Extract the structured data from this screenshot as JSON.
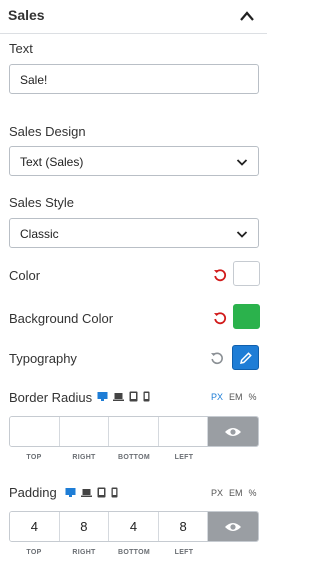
{
  "header": {
    "title": "Sales"
  },
  "text_field": {
    "label": "Text",
    "value": "Sale!"
  },
  "sales_design": {
    "label": "Sales Design",
    "value": "Text (Sales)"
  },
  "sales_style": {
    "label": "Sales Style",
    "value": "Classic"
  },
  "color": {
    "label": "Color",
    "swatch": "#ffffff"
  },
  "background_color": {
    "label": "Background Color",
    "swatch": "#2bb24c"
  },
  "typography": {
    "label": "Typography"
  },
  "border_radius": {
    "label": "Border Radius",
    "units": [
      "PX",
      "EM",
      "%"
    ],
    "active_unit": "PX",
    "values": [
      "",
      "",
      "",
      ""
    ],
    "sides": [
      "TOP",
      "RIGHT",
      "BOTTOM",
      "LEFT"
    ]
  },
  "padding": {
    "label": "Padding",
    "units": [
      "PX",
      "EM",
      "%"
    ],
    "active_unit": "PX",
    "values": [
      "4",
      "8",
      "4",
      "8"
    ],
    "sides": [
      "TOP",
      "RIGHT",
      "BOTTOM",
      "LEFT"
    ]
  },
  "colors": {
    "accent": "#1e7dd6",
    "reset_red": "#d11a1a",
    "link_toggle": "#9a9ea3"
  },
  "icons": [
    "chevron-up-icon",
    "chevron-down-icon",
    "reset-icon",
    "pencil-icon",
    "desktop-icon",
    "laptop-icon",
    "tablet-icon",
    "mobile-icon",
    "eye-icon"
  ]
}
